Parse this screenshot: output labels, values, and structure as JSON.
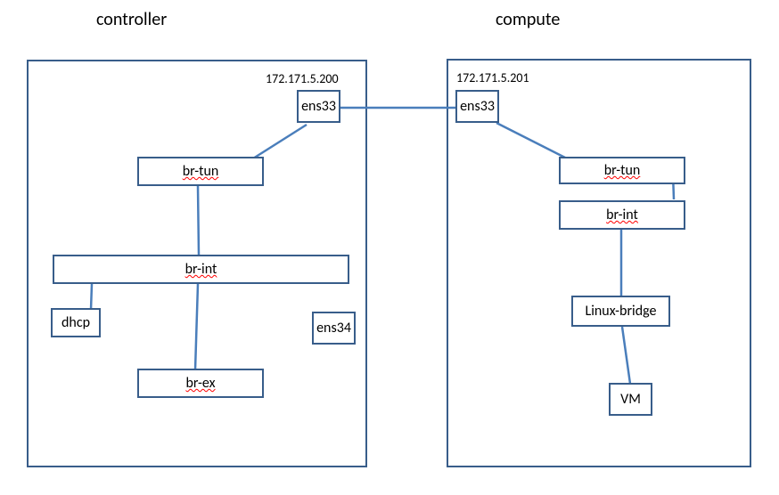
{
  "controller": {
    "title": "controller",
    "ip": "172.171.5.200",
    "nodes": {
      "ens33": "ens33",
      "brtun": "br-tun",
      "brint": "br-int",
      "dhcp": "dhcp",
      "ens34": "ens34",
      "brex": "br-ex"
    }
  },
  "compute": {
    "title": "compute",
    "ip": "172.171.5.201",
    "nodes": {
      "ens33": "ens33",
      "brtun": "br-tun",
      "brint": "br-int",
      "linuxbridge": "Linux-bridge",
      "vm": "VM"
    }
  }
}
